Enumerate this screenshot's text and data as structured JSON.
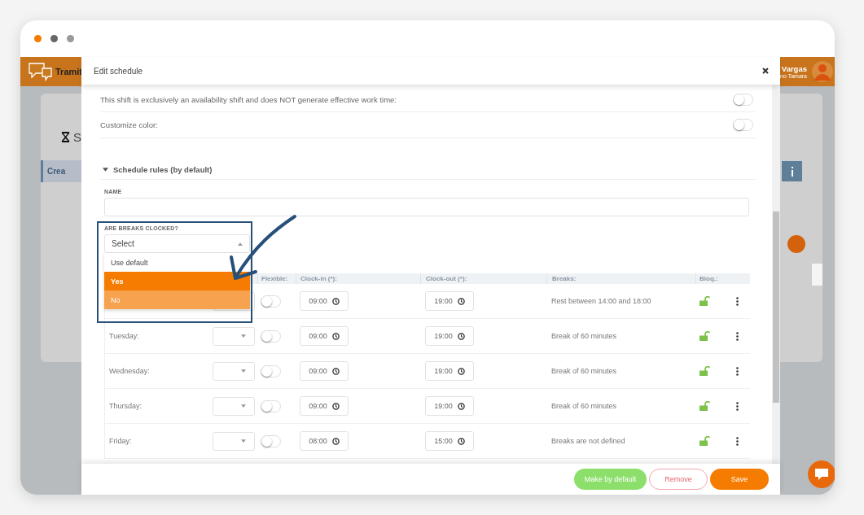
{
  "browser": {
    "dots": [
      {
        "color": "#f57c00"
      },
      {
        "color": "#666666"
      },
      {
        "color": "#999999"
      }
    ]
  },
  "background_app": {
    "brand": "Tramit",
    "page_title": "S",
    "tab": "Crea",
    "user_name": "Vargas",
    "user_subtitle": "no Tamara"
  },
  "modal": {
    "title": "Edit schedule",
    "settings": [
      {
        "label": "This shift is exclusively an availability shift and does NOT generate effective work time:",
        "on": false
      },
      {
        "label": "Customize color:",
        "on": false
      }
    ],
    "section": {
      "title": "Schedule rules (by default)",
      "expanded": true
    },
    "name_field": {
      "label": "NAME"
    },
    "breaks_field": {
      "label": "ARE BREAKS CLOCKED?",
      "placeholder": "Select",
      "open": true,
      "options": [
        {
          "label": "Use default",
          "selected": false,
          "hovered": false
        },
        {
          "label": "Yes",
          "selected": true,
          "hovered": false
        },
        {
          "label": "No",
          "selected": false,
          "hovered": true
        }
      ]
    },
    "table": {
      "columns": [
        "Flexible:",
        "Clock-in (*):",
        "Clock-out (*):",
        "Breaks:",
        "Bloq.:"
      ],
      "rows": [
        {
          "flexible": false,
          "clock_in": "09:00",
          "clock_out": "19:00",
          "breaks": "Rest between 14:00 and 18:00",
          "locked": false
        },
        {
          "day": "Tuesday:",
          "flexible": false,
          "clock_in": "09:00",
          "clock_out": "19:00",
          "breaks": "Break of 60 minutes",
          "locked": false
        },
        {
          "day": "Wednesday:",
          "flexible": false,
          "clock_in": "09:00",
          "clock_out": "19:00",
          "breaks": "Break of 60 minutes",
          "locked": false
        },
        {
          "day": "Thursday:",
          "flexible": false,
          "clock_in": "09:00",
          "clock_out": "19:00",
          "breaks": "Break of 60 minutes",
          "locked": false
        },
        {
          "day": "Friday:",
          "flexible": false,
          "clock_in": "08:00",
          "clock_out": "15:00",
          "breaks": "Breaks are not defined",
          "locked": false
        }
      ]
    },
    "buttons": [
      {
        "label": "Make by default",
        "kind": "success"
      },
      {
        "label": "Remove",
        "kind": "outline"
      },
      {
        "label": "Save",
        "kind": "primary"
      }
    ]
  }
}
